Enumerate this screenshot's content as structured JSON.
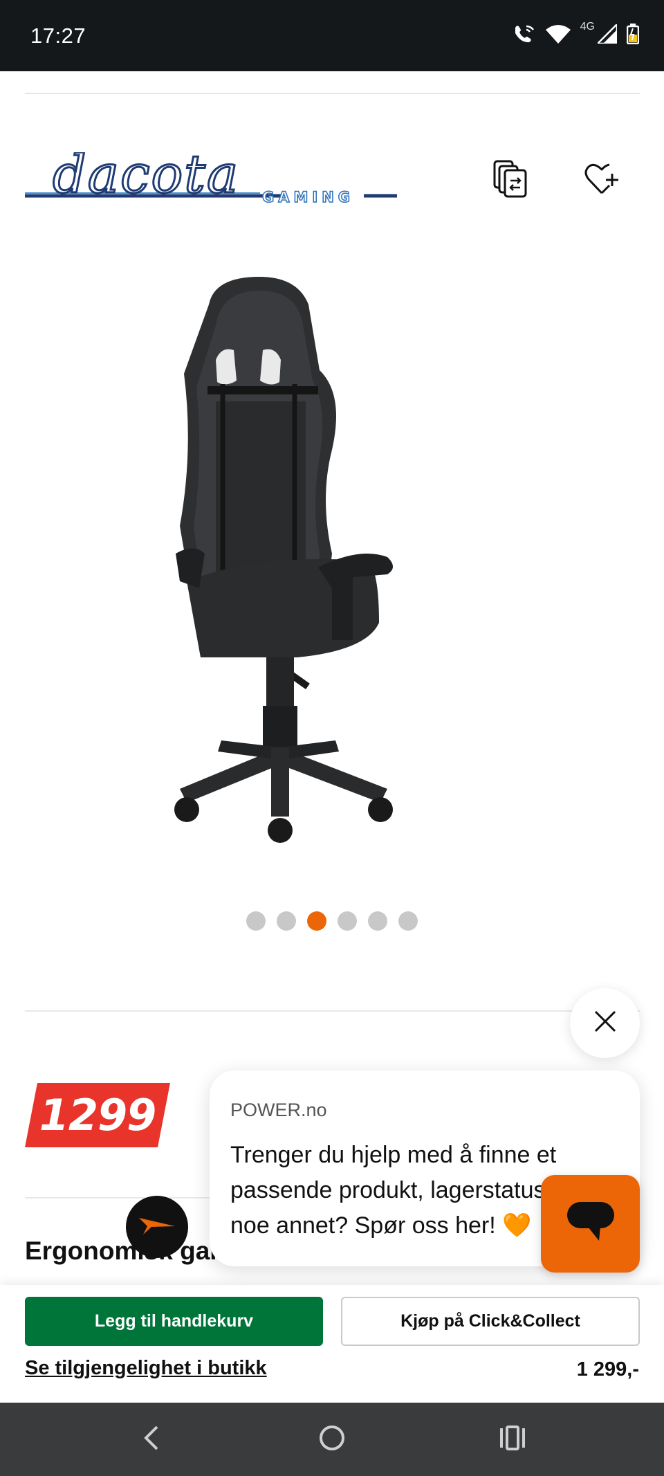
{
  "status_bar": {
    "time": "17:27",
    "network": "4G",
    "icons": [
      "wifi-calling-icon",
      "wifi-icon",
      "signal-icon",
      "battery-icon"
    ]
  },
  "brand": {
    "name": "dacota",
    "sub": "GAMING",
    "color": "#1f3b73",
    "accent": "#3a8fd9"
  },
  "header_actions": {
    "compare_icon": "compare-icon",
    "wishlist_icon": "heart-plus-icon"
  },
  "carousel": {
    "total": 6,
    "active_index": 2
  },
  "price": {
    "badge": "1299",
    "color": "#e8342a"
  },
  "product": {
    "title": "Ergonomisk gaming"
  },
  "chat": {
    "sender": "POWER.no",
    "message": "Trenger du hjelp med å finne et\npassende produkt, lagerstatus eller\nnoe annet? Spør oss her! ",
    "heart": "🧡",
    "close_icon": "close-icon",
    "launcher_icon": "chat-icon",
    "accent": "#ec6608"
  },
  "sticky": {
    "add_to_cart": "Legg til handlekurv",
    "click_collect": "Kjøp på Click&Collect",
    "store_link": "Se tilgjengelighet i butikk",
    "price": "1 299,-",
    "cart_color": "#00753a"
  },
  "nav": {
    "back_icon": "back-icon",
    "home_icon": "home-icon",
    "recents_icon": "recents-icon"
  }
}
